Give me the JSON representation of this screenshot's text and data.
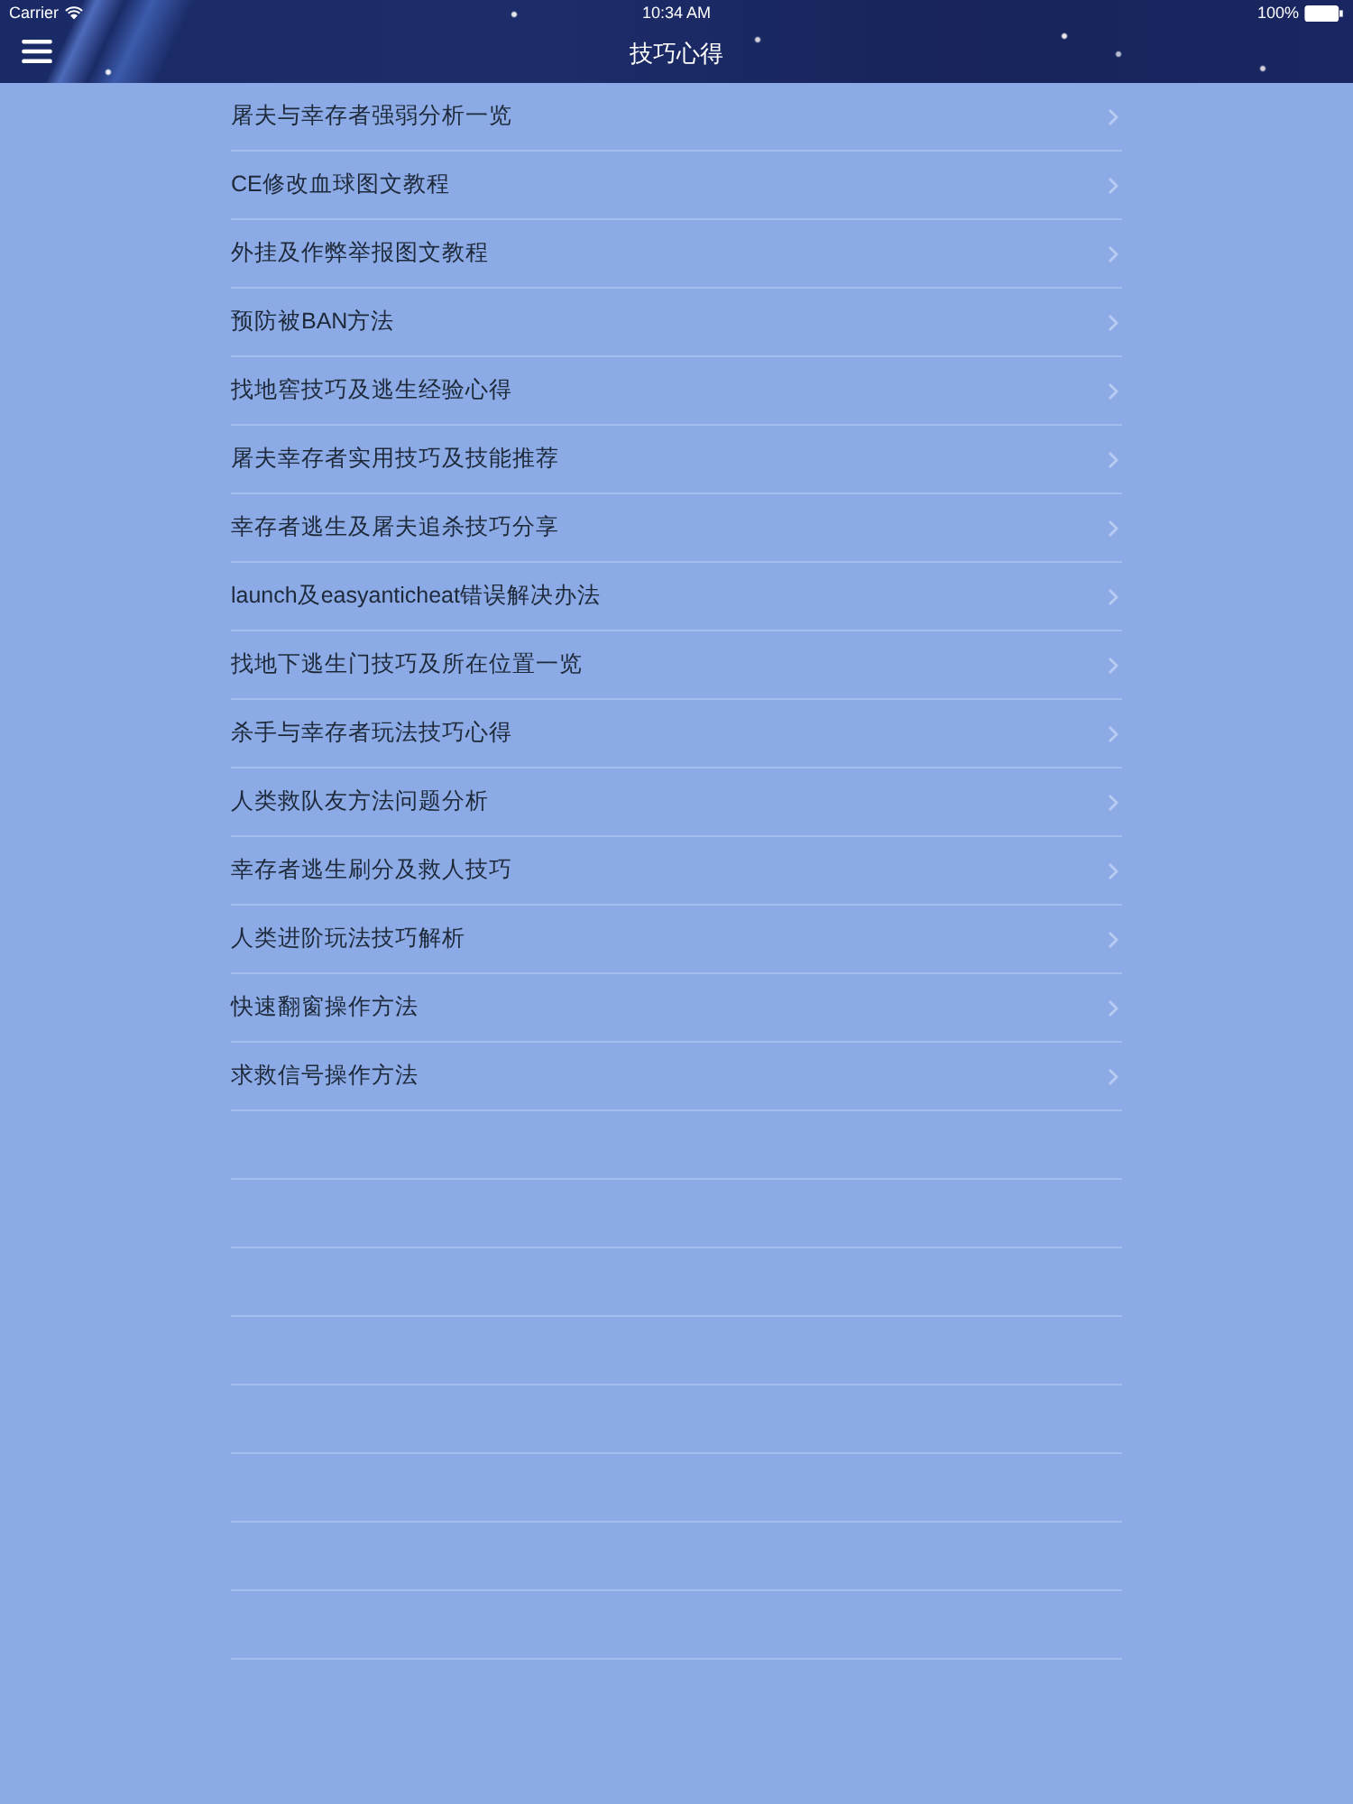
{
  "status_bar": {
    "carrier": "Carrier",
    "time": "10:34 AM",
    "battery": "100%"
  },
  "nav_bar": {
    "title": "技巧心得"
  },
  "list": {
    "items": [
      "屠夫与幸存者强弱分析一览",
      "CE修改血球图文教程",
      "外挂及作弊举报图文教程",
      "预防被BAN方法",
      "找地窖技巧及逃生经验心得",
      "屠夫幸存者实用技巧及技能推荐",
      "幸存者逃生及屠夫追杀技巧分享",
      "launch及easyanticheat错误解决办法",
      "找地下逃生门技巧及所在位置一览",
      "杀手与幸存者玩法技巧心得",
      "人类救队友方法问题分析",
      "幸存者逃生刷分及救人技巧",
      "人类进阶玩法技巧解析",
      "快速翻窗操作方法",
      "求救信号操作方法"
    ]
  }
}
